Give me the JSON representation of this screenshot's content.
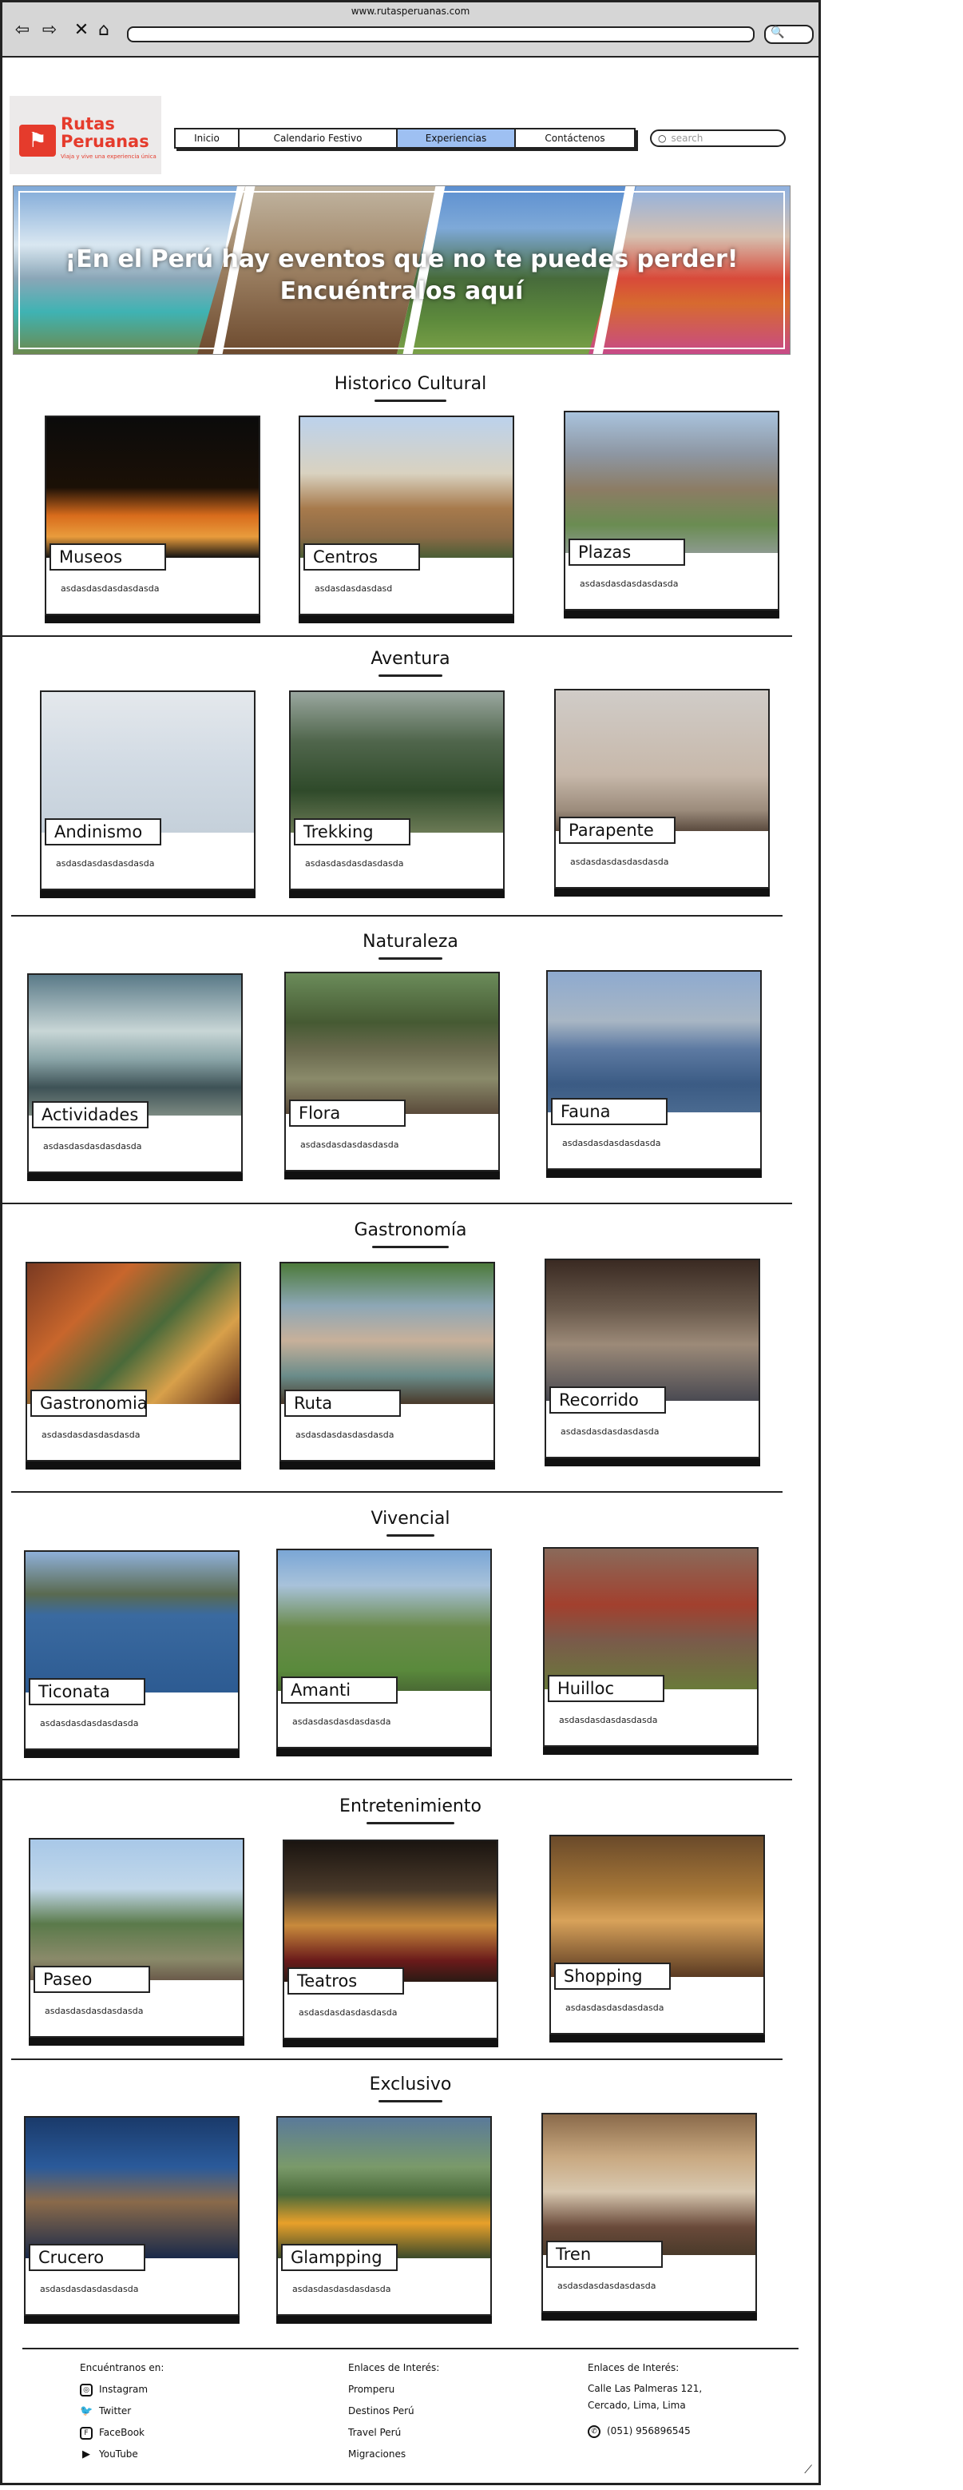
{
  "browser": {
    "url": "www.rutasperuanas.com",
    "back_icon": "arrow-left-icon",
    "forward_icon": "arrow-right-icon",
    "stop_icon": "x-icon",
    "home_icon": "home-icon",
    "search_icon": "search-icon"
  },
  "brand": {
    "name_line1": "Rutas",
    "name_line2": "Peruanas",
    "tagline": "Viaja y vive una experiencia única",
    "accent": "#e53b2c"
  },
  "nav": {
    "items": [
      {
        "label": "Inicio",
        "active": false
      },
      {
        "label": "Calendario Festivo",
        "active": false
      },
      {
        "label": "Experiencias",
        "active": true
      },
      {
        "label": "Contáctenos",
        "active": false
      }
    ],
    "active_color": "#9ec0f2"
  },
  "search": {
    "placeholder": "search"
  },
  "banner": {
    "line1": "¡En el Perú hay eventos que no te puedes perder!",
    "line2": "Encuéntralos aquí"
  },
  "sections": [
    {
      "title": "Historico Cultural",
      "cards": [
        {
          "label": "Museos",
          "desc": "asdasdasdasdasdasda"
        },
        {
          "label": "Centros",
          "desc": "asdasdasdasdasd"
        },
        {
          "label": "Plazas",
          "desc": "asdasdasdasdasdasda"
        }
      ]
    },
    {
      "title": "Aventura",
      "cards": [
        {
          "label": "Andinismo",
          "desc": "asdasdasdasdasdasda"
        },
        {
          "label": "Trekking",
          "desc": "asdasdasdasdasdasda"
        },
        {
          "label": "Parapente",
          "desc": "asdasdasdasdasdasda"
        }
      ]
    },
    {
      "title": "Naturaleza",
      "cards": [
        {
          "label": "Actividades",
          "desc": "asdasdasdasdasdasda"
        },
        {
          "label": "Flora",
          "desc": "asdasdasdasdasdasda"
        },
        {
          "label": "Fauna",
          "desc": "asdasdasdasdasdasda"
        }
      ]
    },
    {
      "title": "Gastronomía",
      "cards": [
        {
          "label": "Gastronomia",
          "desc": "asdasdasdasdasdasda"
        },
        {
          "label": "Ruta",
          "desc": "asdasdasdasdasdasda"
        },
        {
          "label": "Recorrido",
          "desc": "asdasdasdasdasdasda"
        }
      ]
    },
    {
      "title": "Vivencial",
      "cards": [
        {
          "label": "Ticonata",
          "desc": "asdasdasdasdasdasda"
        },
        {
          "label": "Amanti",
          "desc": "asdasdasdasdasdasda"
        },
        {
          "label": "Huilloc",
          "desc": "asdasdasdasdasdasda"
        }
      ]
    },
    {
      "title": "Entretenimiento",
      "cards": [
        {
          "label": "Paseo",
          "desc": "asdasdasdasdasdasda"
        },
        {
          "label": "Teatros",
          "desc": "asdasdasdasdasdasda"
        },
        {
          "label": "Shopping",
          "desc": "asdasdasdasdasdasda"
        }
      ]
    },
    {
      "title": "Exclusivo",
      "cards": [
        {
          "label": "Crucero",
          "desc": "asdasdasdasdasdasda"
        },
        {
          "label": "Glampping",
          "desc": "asdasdasdasdasdasda"
        },
        {
          "label": "Tren",
          "desc": "asdasdasdasdasdasda"
        }
      ]
    }
  ],
  "footer": {
    "social_heading": "Encuéntranos en:",
    "social": [
      {
        "label": "Instagram",
        "icon": "instagram-icon"
      },
      {
        "label": "Twitter",
        "icon": "twitter-icon"
      },
      {
        "label": "FaceBook",
        "icon": "facebook-icon"
      },
      {
        "label": "YouTube",
        "icon": "youtube-icon"
      }
    ],
    "links_heading": "Enlaces de Interés:",
    "links": [
      "Promperu",
      "Destinos Perú",
      "Travel Perú",
      "Migraciones"
    ],
    "contact_heading": "Enlaces de Interés:",
    "address_line1": "Calle Las Palmeras 121,",
    "address_line2": "Cercado, Lima, Lima",
    "phone": "(051) 956896545",
    "phone_icon": "whatsapp-icon"
  }
}
